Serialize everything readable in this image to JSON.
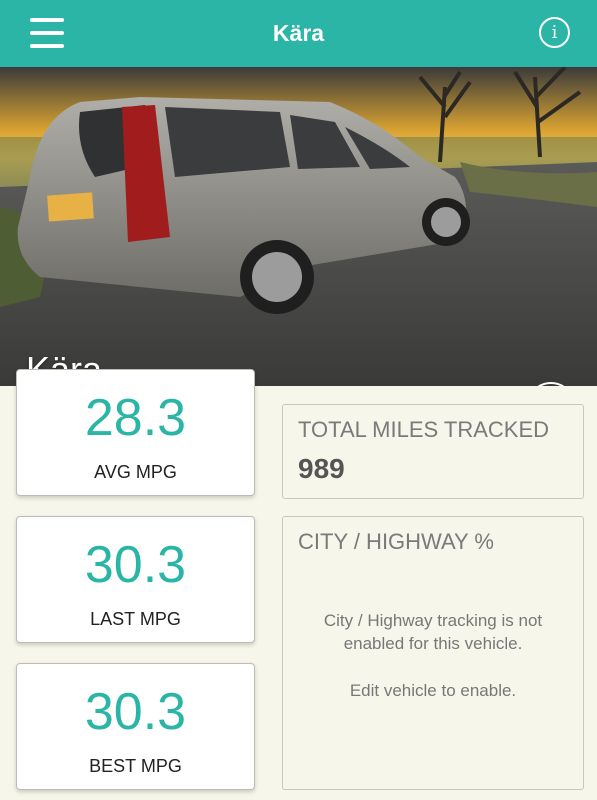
{
  "header": {
    "title": "Kära",
    "menu_icon": "hamburger-menu-icon",
    "info_icon": "info-icon",
    "info_glyph": "i"
  },
  "hero": {
    "vehicle_name": "Kära",
    "camera_icon": "add-photo-camera-icon"
  },
  "stats": [
    {
      "value": "28.3",
      "label": "AVG MPG"
    },
    {
      "value": "30.3",
      "label": "LAST MPG"
    },
    {
      "value": "30.3",
      "label": "BEST MPG"
    }
  ],
  "total_miles": {
    "heading": "TOTAL MILES TRACKED",
    "value": "989"
  },
  "city_highway": {
    "heading": "CITY / HIGHWAY %",
    "message": "City / Highway tracking is not enabled for this vehicle.",
    "hint": "Edit vehicle to enable."
  },
  "colors": {
    "accent": "#2bb5a6",
    "background": "#f7f6ea",
    "card": "#ffffff"
  }
}
